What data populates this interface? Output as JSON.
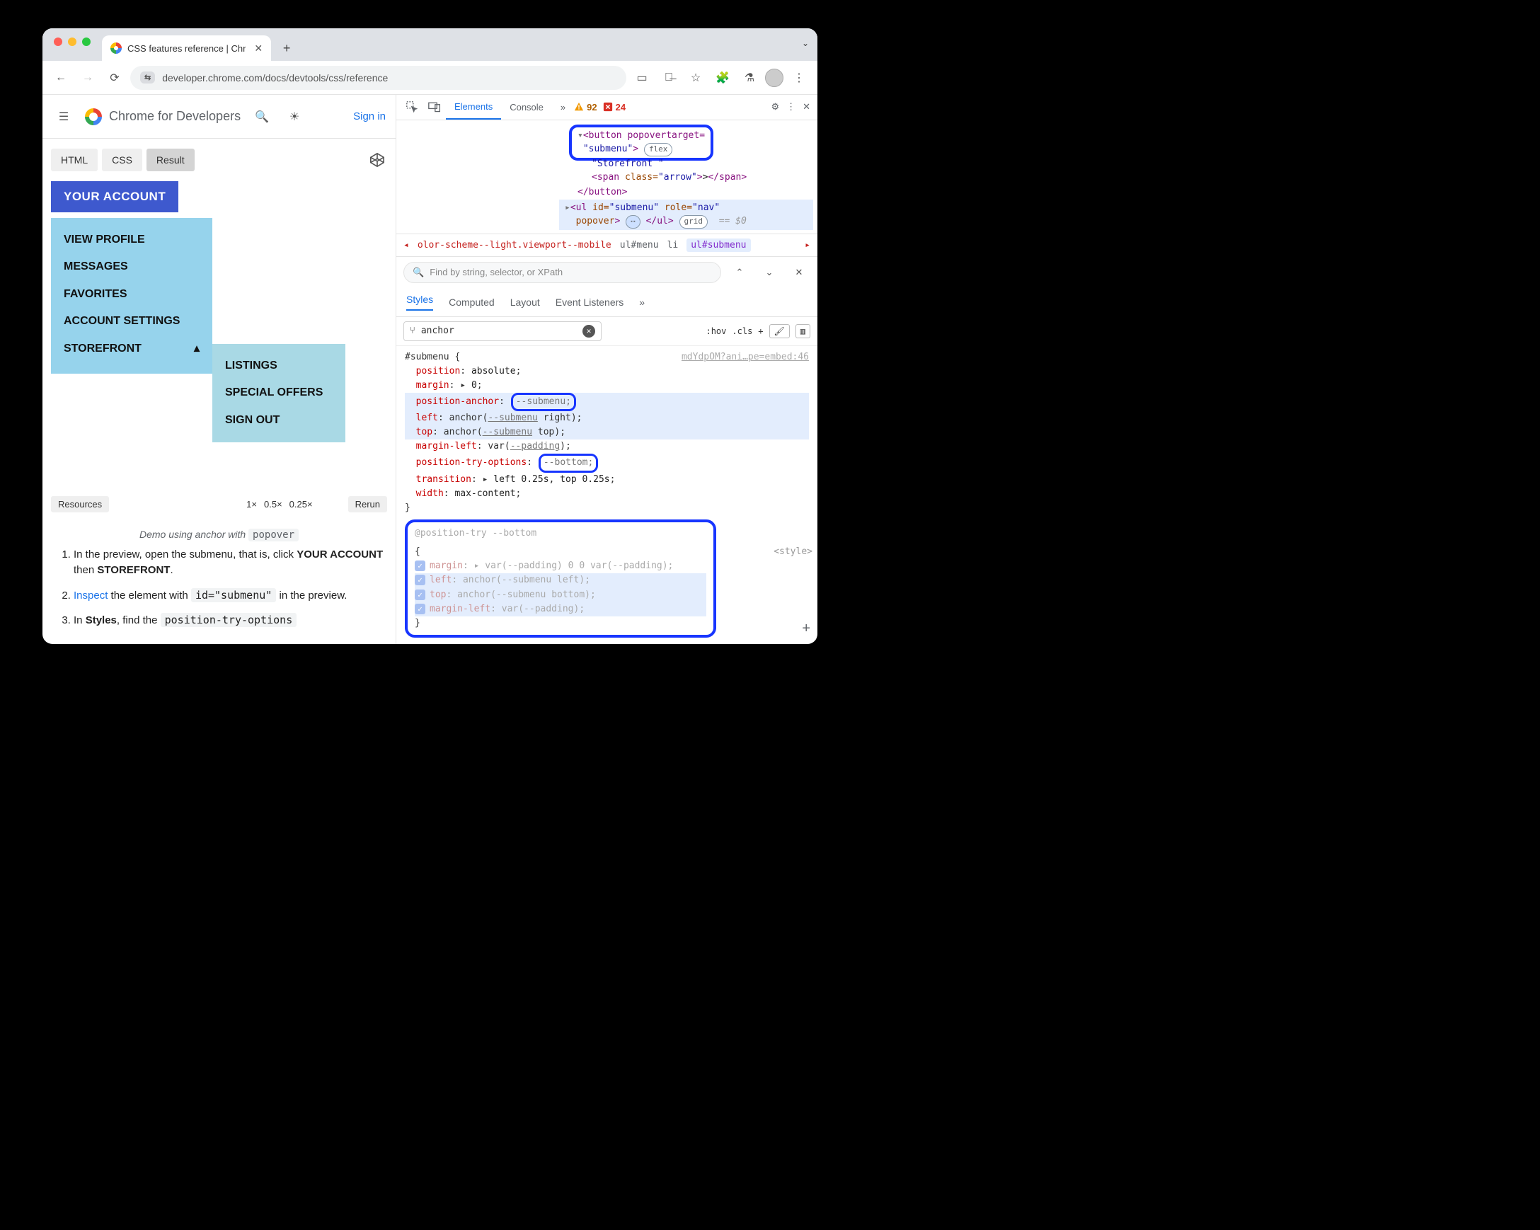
{
  "browser": {
    "tabTitle": "CSS features reference | Chr",
    "url": "developer.chrome.com/docs/devtools/css/reference",
    "siteSetting": "⇆"
  },
  "siteHeader": {
    "brand": "Chrome for Developers",
    "signIn": "Sign in"
  },
  "embedTabs": {
    "html": "HTML",
    "css": "CSS",
    "result": "Result"
  },
  "menu": {
    "primary": "YOUR ACCOUNT",
    "items": [
      "VIEW PROFILE",
      "MESSAGES",
      "FAVORITES",
      "ACCOUNT SETTINGS",
      "STOREFRONT"
    ],
    "sub": [
      "LISTINGS",
      "SPECIAL OFFERS",
      "SIGN OUT"
    ]
  },
  "footer": {
    "resources": "Resources",
    "scale": [
      "1×",
      "0.5×",
      "0.25×"
    ],
    "rerun": "Rerun"
  },
  "caption": {
    "text": "Demo using anchor with ",
    "code": "popover"
  },
  "steps": {
    "s1a": "In the preview, open the submenu, that is, click ",
    "s1b": "YOUR ACCOUNT",
    "s1c": " then ",
    "s1d": "STOREFRONT",
    "s1e": ".",
    "s2a": "Inspect",
    "s2b": " the element with ",
    "s2code": "id=\"submenu\"",
    "s2c": " in the preview.",
    "s3a": "In ",
    "s3b": "Styles",
    "s3c": ", find the ",
    "s3code": "position-try-options"
  },
  "devtools": {
    "tabs": {
      "elements": "Elements",
      "console": "Console"
    },
    "warnCount": "92",
    "errCount": "24",
    "dom": {
      "buttonOpen": "<button popovertarget=",
      "buttonTarget": "\"submenu\"",
      "flexBadge": "flex",
      "text1": "\"Storefront \"",
      "spanOpen": "<span class=\"arrow\">",
      "spanText": ">",
      "spanClose": "</span>",
      "buttonClose": "</button>",
      "ulOpen1": "<ul id=\"submenu\" role=\"nav\"",
      "ulOpen2": "popover>",
      "ellipsis": "⋯",
      "ulClose": "</ul>",
      "gridBadge": "grid",
      "dims": "== $0"
    },
    "crumbs": {
      "c0": "olor-scheme--light.viewport--mobile",
      "c1": "ul#menu",
      "c2": "li",
      "cur": "ul#submenu"
    },
    "find": {
      "placeholder": "Find by string, selector, or XPath"
    },
    "panelTabs": {
      "styles": "Styles",
      "computed": "Computed",
      "layout": "Layout",
      "listeners": "Event Listeners"
    },
    "filter": {
      "value": "anchor",
      "hov": ":hov",
      "cls": ".cls"
    },
    "rules": {
      "selector": "#submenu {",
      "source": "mdYdpOM?ani…pe=embed:46",
      "r": [
        {
          "prop": "position",
          "pre": ": ",
          "val": "absolute",
          "post": ";"
        },
        {
          "prop": "margin",
          "pre": ": ▸ ",
          "val": "0",
          "post": ";"
        },
        {
          "prop": "position-anchor",
          "pre": ": ",
          "pill": "--submenu;",
          "post": "",
          "hl": true
        },
        {
          "prop": "left",
          "pre": ": anchor(",
          "var": "--submenu",
          "mid": " right)",
          "post": ";",
          "hl": true
        },
        {
          "prop": "top",
          "pre": ": anchor(",
          "var": "--submenu",
          "mid": " top)",
          "post": ";",
          "hl": true
        },
        {
          "prop": "margin-left",
          "pre": ": var(",
          "var": "--padding",
          "mid": ")",
          "post": ";"
        },
        {
          "prop": "position-try-options",
          "pre": ": ",
          "pill": "--bottom;",
          "post": ""
        },
        {
          "prop": "transition",
          "pre": ": ▸ ",
          "val": "left 0.25s, top 0.25s",
          "post": ";"
        },
        {
          "prop": "width",
          "pre": ": ",
          "val": "max-content",
          "post": ";"
        }
      ],
      "close": "}"
    },
    "tryRule": {
      "header": "@position-try --bottom",
      "open": "{",
      "styleSrc": "<style>",
      "lines": [
        {
          "prop": "margin",
          "rest": ": ▸ var(--padding) 0 0 var(--padding);"
        },
        {
          "prop": "left",
          "rest": ": anchor(--submenu left);",
          "hl": true
        },
        {
          "prop": "top",
          "rest": ": anchor(--submenu bottom);",
          "hl": true
        },
        {
          "prop": "margin-left",
          "rest": ": var(--padding);",
          "hl": true
        }
      ],
      "close": "}"
    }
  }
}
